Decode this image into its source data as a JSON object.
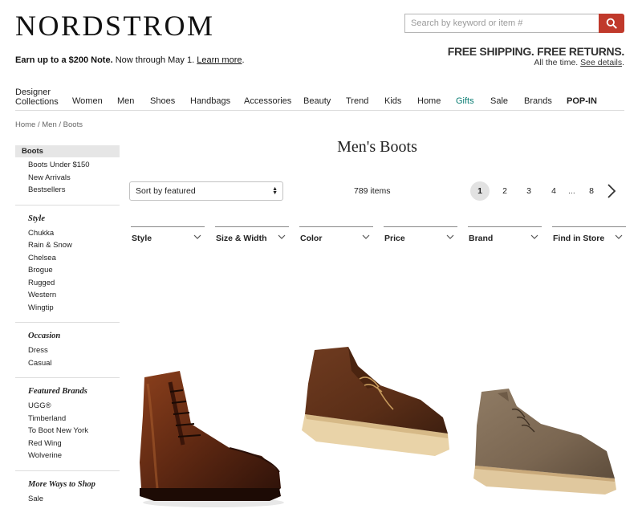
{
  "brand": {
    "logo_text": "NORDSTROM"
  },
  "search": {
    "placeholder": "Search by keyword or item #"
  },
  "promo": {
    "bold_text": "Earn up to a $200 Note.",
    "text": " Now through May 1. ",
    "link_text": "Learn more",
    "period": "."
  },
  "shipping": {
    "headline": "FREE SHIPPING. FREE RETURNS.",
    "subtext": "All the time. ",
    "link_text": "See details",
    "period": "."
  },
  "nav": {
    "items": [
      {
        "label": "Designer Collections"
      },
      {
        "label": "Women"
      },
      {
        "label": "Men"
      },
      {
        "label": "Shoes"
      },
      {
        "label": "Handbags"
      },
      {
        "label": "Accessories"
      },
      {
        "label": "Beauty"
      },
      {
        "label": "Trend"
      },
      {
        "label": "Kids"
      },
      {
        "label": "Home"
      },
      {
        "label": "Gifts"
      },
      {
        "label": "Sale"
      },
      {
        "label": "Brands"
      },
      {
        "label": "POP-IN"
      }
    ]
  },
  "breadcrumb": {
    "items": [
      "Home",
      "Men",
      "Boots"
    ],
    "separator": "/"
  },
  "sidebar": {
    "active": "Boots",
    "top_links": [
      "Boots Under $150",
      "New Arrivals",
      "Bestsellers"
    ],
    "sections": [
      {
        "heading": "Style",
        "links": [
          "Chukka",
          "Rain & Snow",
          "Chelsea",
          "Brogue",
          "Rugged",
          "Western",
          "Wingtip"
        ]
      },
      {
        "heading": "Occasion",
        "links": [
          "Dress",
          "Casual"
        ]
      },
      {
        "heading": "Featured Brands",
        "links": [
          "UGG®",
          "Timberland",
          "To Boot New York",
          "Red Wing",
          "Wolverine"
        ]
      },
      {
        "heading": "More Ways to Shop",
        "links": [
          "Sale"
        ]
      }
    ]
  },
  "main": {
    "title": "Men's Boots",
    "sort": {
      "selected": "Sort by featured"
    },
    "item_count": "789 items",
    "pagination": {
      "pages": [
        "1",
        "2",
        "3",
        "4"
      ],
      "ellipsis": "...",
      "last": "8",
      "current": "1"
    },
    "filters": [
      "Style",
      "Size & Width",
      "Color",
      "Price",
      "Brand",
      "Find in Store"
    ]
  },
  "icons": {
    "search": "search-icon",
    "next": "chevron-right-icon",
    "filter": "chevron-down-icon"
  },
  "colors": {
    "search_button": "#c0392b",
    "gifts_link": "#0a7d73",
    "current_page_bg": "#e2e2e2"
  }
}
